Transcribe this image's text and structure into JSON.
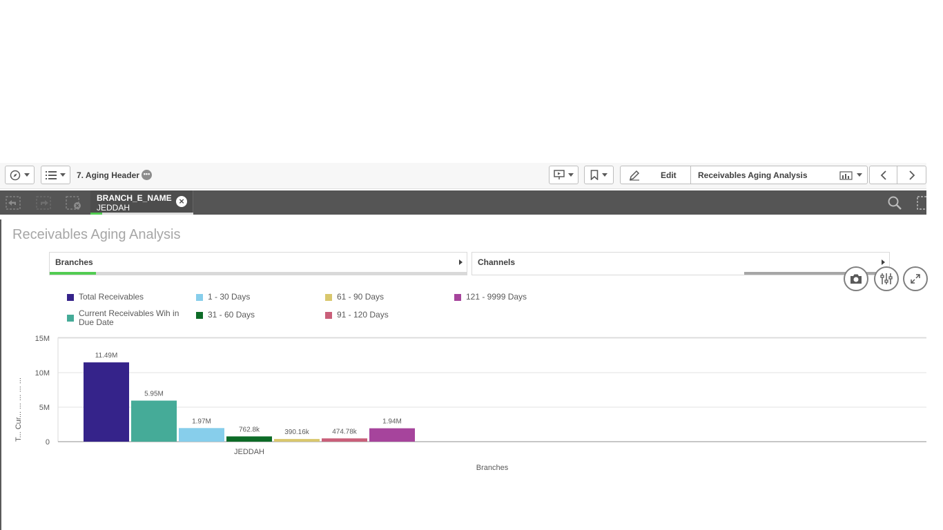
{
  "toolbar": {
    "sheet_title": "7. Aging Header",
    "sheet_more": "•••",
    "edit_label": "Edit",
    "sheet_selector": "Receivables Aging Analysis"
  },
  "selections": {
    "field": "BRANCH_E_NAME",
    "value": "JEDDAH"
  },
  "filters": {
    "branches": "Branches",
    "channels": "Channels"
  },
  "chart_title": "Receivables Aging Analysis",
  "legend": [
    {
      "label": "Total Receivables",
      "color": "#35238a"
    },
    {
      "label": "1 - 30 Days",
      "color": "#87ceeb"
    },
    {
      "label": "61 - 90 Days",
      "color": "#d9c76d"
    },
    {
      "label": "121 - 9999 Days",
      "color": "#a6449c"
    },
    {
      "label": "Current Receivables Wih in Due Date",
      "color": "#45ab98"
    },
    {
      "label": "31 - 60 Days",
      "color": "#0d6b27"
    },
    {
      "label": "91 - 120 Days",
      "color": "#c95f79"
    }
  ],
  "chart_data": {
    "type": "bar",
    "categories": [
      "JEDDAH"
    ],
    "xlabel": "Branches",
    "ylabel": "T... Cur... ... ... ... ...",
    "ylim": [
      0,
      15000000
    ],
    "yticks": [
      {
        "value": 0,
        "label": "0"
      },
      {
        "value": 5000000,
        "label": "5M"
      },
      {
        "value": 10000000,
        "label": "10M"
      },
      {
        "value": 15000000,
        "label": "15M"
      }
    ],
    "series": [
      {
        "name": "Total Receivables",
        "values": [
          11490000
        ],
        "label": "11.49M",
        "color": "#35238a"
      },
      {
        "name": "Current Receivables Wih in Due Date",
        "values": [
          5950000
        ],
        "label": "5.95M",
        "color": "#45ab98"
      },
      {
        "name": "1 - 30 Days",
        "values": [
          1970000
        ],
        "label": "1.97M",
        "color": "#87ceeb"
      },
      {
        "name": "31 - 60 Days",
        "values": [
          762800
        ],
        "label": "762.8k",
        "color": "#0d6b27"
      },
      {
        "name": "61 - 90 Days",
        "values": [
          390160
        ],
        "label": "390.16k",
        "color": "#d9c76d"
      },
      {
        "name": "91 - 120 Days",
        "values": [
          474780
        ],
        "label": "474.78k",
        "color": "#c95f79"
      },
      {
        "name": "121 - 9999 Days",
        "values": [
          1940000
        ],
        "label": "1.94M",
        "color": "#a6449c"
      }
    ],
    "grid": true,
    "legend_position": "top"
  }
}
